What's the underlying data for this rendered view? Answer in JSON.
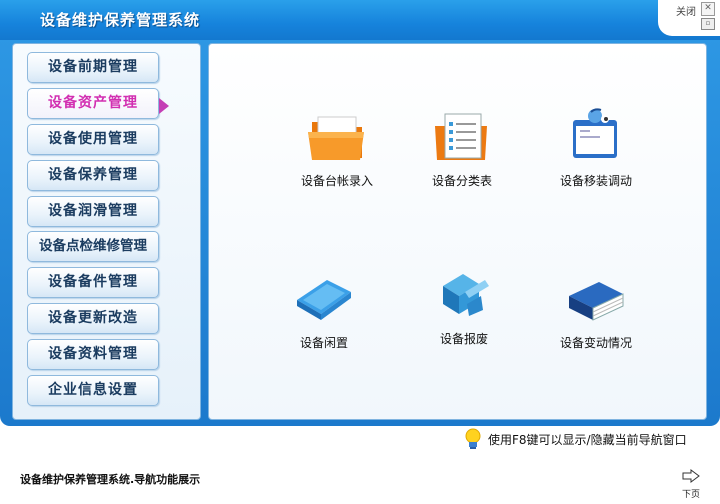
{
  "window": {
    "title": "设备维护保养管理系统",
    "close_label": "关闭",
    "close_icon": "close-icon",
    "maximize_icon": "maximize-icon"
  },
  "sidebar": {
    "items": [
      {
        "label": "设备前期管理"
      },
      {
        "label": "设备资产管理",
        "active": true
      },
      {
        "label": "设备使用管理"
      },
      {
        "label": "设备保养管理"
      },
      {
        "label": "设备润滑管理"
      },
      {
        "label": "设备点检维修管理"
      },
      {
        "label": "设备备件管理"
      },
      {
        "label": "设备更新改造"
      },
      {
        "label": "设备资料管理"
      },
      {
        "label": "企业信息设置"
      }
    ],
    "active_color": "#d22fb1"
  },
  "main": {
    "tiles": [
      {
        "label": "设备台帐录入",
        "icon": "orange-folder-icon"
      },
      {
        "label": "设备分类表",
        "icon": "document-list-icon"
      },
      {
        "label": "设备移装调动",
        "icon": "calendar-icon"
      },
      {
        "label": "设备闲置",
        "icon": "blue-folder-icon"
      },
      {
        "label": "设备报废",
        "icon": "broken-box-icon"
      },
      {
        "label": "设备变动情况",
        "icon": "blue-book-icon"
      }
    ]
  },
  "hint": {
    "text": "使用F8键可以显示/隐藏当前导航窗口",
    "icon": "lightbulb-icon"
  },
  "status": {
    "text": "设备维护保养管理系统.导航功能展示"
  },
  "next": {
    "label": "下页",
    "icon": "next-page-icon"
  }
}
